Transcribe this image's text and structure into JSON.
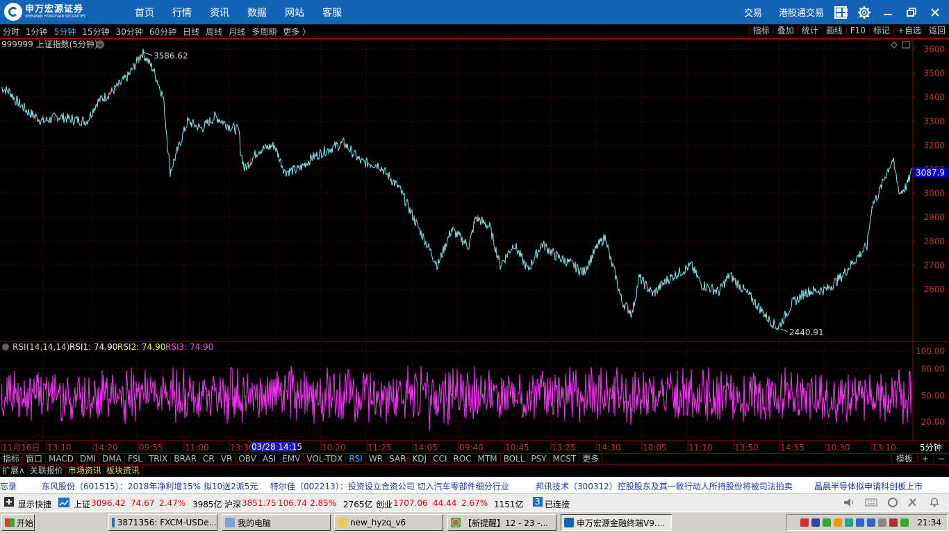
{
  "app": {
    "logo_cn": "申万宏源证券",
    "logo_en": "SHENWAN HONGYUAN SECURITIES",
    "nav": [
      "首页",
      "行情",
      "资讯",
      "数据",
      "网站",
      "客服"
    ],
    "right_links": [
      "交易",
      "港股通交易"
    ],
    "icons": [
      "grid-icon",
      "gear-icon",
      "minimize-icon",
      "restore-icon",
      "close-icon"
    ]
  },
  "periods": {
    "items": [
      "分时",
      "1分钟",
      "5分钟",
      "15分钟",
      "30分钟",
      "60分钟",
      "日线",
      "周线",
      "月线",
      "多周期",
      "更多 〉"
    ],
    "active": "5分钟",
    "right_tools": [
      "指标",
      "叠加",
      "统计",
      "画线",
      "F10",
      "标记",
      "+自选",
      "返回"
    ]
  },
  "main_chart": {
    "title": "999999 上证指数(5分钟)",
    "max_label": "3586.62",
    "min_label": "2440.91",
    "current_price": "3087.9",
    "y_ticks": [
      "3600",
      "3500",
      "3400",
      "3300",
      "3200",
      "3100",
      "3000",
      "2900",
      "2800",
      "2700",
      "2600"
    ],
    "colors": {
      "line": "#7fe9f2",
      "up": "#ff3030",
      "grid": "#5a0000",
      "price_box": "#0000c8"
    }
  },
  "rsi": {
    "title": "RSI(14,14,14)",
    "rsi1": "RSI1: 74.90",
    "rsi2": "RSI2: 74.90",
    "rsi3": "RSI3: 74.90",
    "y_ticks": [
      "100.00",
      "80.00",
      "50.00",
      "20.00"
    ],
    "color": "#ff30ff"
  },
  "time_axis": {
    "labels": [
      "11月16日",
      "13:10",
      "14:20",
      "09:55",
      "11:00",
      "13:30",
      "10:20",
      "11:25",
      "14:05",
      "09:40",
      "10:45",
      "13:25",
      "14:30",
      "10:05",
      "11:10",
      "13:50",
      "14:55",
      "10:30",
      "13:10"
    ],
    "highlight": "03/28 14:15",
    "period_label": "5分钟"
  },
  "indicators": {
    "items": [
      "指标",
      "窗口",
      "MACD",
      "DMI",
      "DMA",
      "FSL",
      "TRIX",
      "BRAR",
      "CR",
      "VR",
      "OBV",
      "ASI",
      "EMV",
      "VOL-TDX",
      "RSI",
      "WR",
      "SAR",
      "KDJ",
      "CCI",
      "ROC",
      "MTM",
      "BOLL",
      "PSY",
      "MCST",
      "更多"
    ],
    "active": "RSI",
    "right": [
      "模板",
      "+",
      "−"
    ]
  },
  "tabs": [
    "扩展∧",
    "关联报价",
    "市场资讯",
    "板块资讯"
  ],
  "ticker": [
    "忘录",
    "东风股份（601515）：2018年净利增15% 拟10送2派5元",
    "特尔佳（002213）：投资设立合资公司  切入汽车零部件细分行业",
    "邦讯技术（300312）控股股东及其一致行动人所持股份将被司法拍卖",
    "晶晨半导体拟申请科创板上市"
  ],
  "status": {
    "shortcut": "显示快捷",
    "sh_label": "上证",
    "sh_val": "3096.42",
    "sh_chg": "74.67",
    "sh_pct": "2.47%",
    "sh_amt": "3985亿",
    "hs_label": "沪深",
    "hs_val": "3851.75",
    "hs_chg": "106.74",
    "hs_pct": "2.85%",
    "hs_amt": "2765亿",
    "cy_label": "创业",
    "cy_val": "1707.06",
    "cy_chg": "44.44",
    "cy_pct": "2.67%",
    "cy_amt": "1151亿",
    "conn_num": "3",
    "conn_text": "已连接"
  },
  "taskbar": {
    "start": "开始",
    "tasks": [
      "3871356: FXCM-USDe...",
      "我的电脑",
      "new_hyzq_v6",
      "【新提醒】12 - 23 -...",
      "申万宏源金融终端V9...."
    ],
    "clock": "21:34"
  }
}
